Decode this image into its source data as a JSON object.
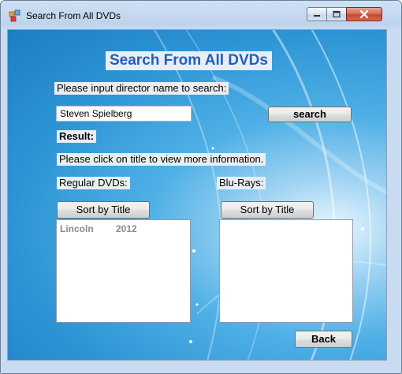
{
  "window": {
    "title": "Search From All DVDs"
  },
  "form": {
    "heading": "Search From All DVDs",
    "director_prompt": "Please input director name to search:",
    "director_value": "Steven Spielberg",
    "search_button": "search",
    "result_label": "Result:",
    "instruction": "Please click on title to view more information.",
    "regular_label": "Regular DVDs:",
    "bluray_label": "Blu-Rays:",
    "sort_regular_button": "Sort by Title",
    "sort_bluray_button": "Sort by Title",
    "back_button": "Back"
  },
  "regular_dvds": [
    {
      "title": "Lincoln",
      "year": "2012"
    }
  ],
  "blu_rays": []
}
